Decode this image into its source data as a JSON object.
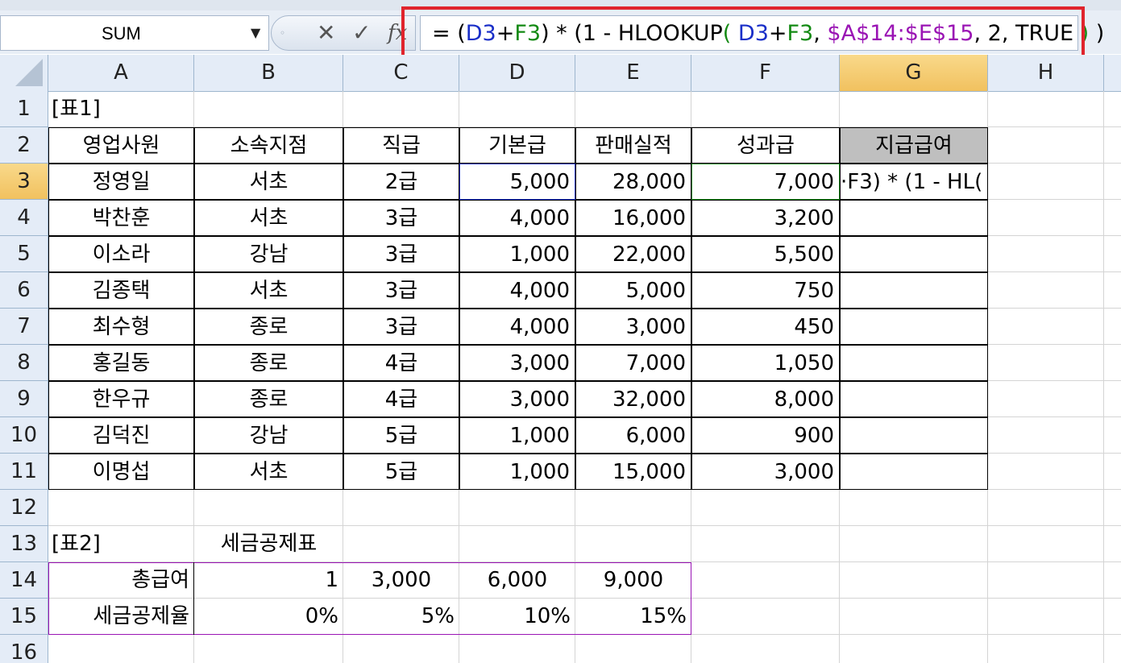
{
  "namebox": {
    "value": "SUM"
  },
  "formula_bar": {
    "parts": [
      {
        "text": " = (",
        "color": "#000000"
      },
      {
        "text": "D3",
        "color": "#1a2fc8"
      },
      {
        "text": "+",
        "color": "#000000"
      },
      {
        "text": "F3",
        "color": "#138a13"
      },
      {
        "text": ") * (1 - HLOOKUP",
        "color": "#000000"
      },
      {
        "text": "(",
        "color": "#148a14"
      },
      {
        "text": " D3",
        "color": "#1a2fc8"
      },
      {
        "text": "+",
        "color": "#000000"
      },
      {
        "text": "F3",
        "color": "#138a13"
      },
      {
        "text": ", ",
        "color": "#000000"
      },
      {
        "text": "$A$14:$E$15",
        "color": "#9a14b4"
      },
      {
        "text": ", 2, TRUE ",
        "color": "#000000"
      },
      {
        "text": ")",
        "color": "#148a14"
      },
      {
        "text": " )",
        "color": "#000000"
      }
    ],
    "cancel_icon": "x-icon",
    "enter_icon": "check-icon",
    "fx_icon": "fx-icon"
  },
  "columns": [
    "A",
    "B",
    "C",
    "D",
    "E",
    "F",
    "G",
    "H"
  ],
  "selected_column": "G",
  "rows": [
    "1",
    "2",
    "3",
    "4",
    "5",
    "6",
    "7",
    "8",
    "9",
    "10",
    "11",
    "12",
    "13",
    "14",
    "15",
    "16"
  ],
  "selected_row": "3",
  "table1": {
    "label": "[표1]",
    "headers": [
      "영업사원",
      "소속지점",
      "직급",
      "기본급",
      "판매실적",
      "성과급",
      "지급급여"
    ],
    "data": [
      [
        "정영일",
        "서초",
        "2급",
        "5,000",
        "28,000",
        "7,000",
        "·F3) * (1 - HL("
      ],
      [
        "박찬훈",
        "서초",
        "3급",
        "4,000",
        "16,000",
        "3,200",
        ""
      ],
      [
        "이소라",
        "강남",
        "3급",
        "1,000",
        "22,000",
        "5,500",
        ""
      ],
      [
        "김종택",
        "서초",
        "3급",
        "4,000",
        "5,000",
        "750",
        ""
      ],
      [
        "최수형",
        "종로",
        "3급",
        "4,000",
        "3,000",
        "450",
        ""
      ],
      [
        "홍길동",
        "종로",
        "4급",
        "3,000",
        "7,000",
        "1,050",
        ""
      ],
      [
        "한우규",
        "종로",
        "4급",
        "3,000",
        "32,000",
        "8,000",
        ""
      ],
      [
        "김덕진",
        "강남",
        "5급",
        "1,000",
        "6,000",
        "900",
        ""
      ],
      [
        "이명섭",
        "서초",
        "5급",
        "1,000",
        "15,000",
        "3,000",
        ""
      ]
    ]
  },
  "table2": {
    "label": "[표2]",
    "title": "세금공제표",
    "row14": [
      "총급여",
      "1",
      "3,000",
      "6,000",
      "9,000"
    ],
    "row15": [
      "세금공제율",
      "0%",
      "5%",
      "10%",
      "15%"
    ]
  }
}
